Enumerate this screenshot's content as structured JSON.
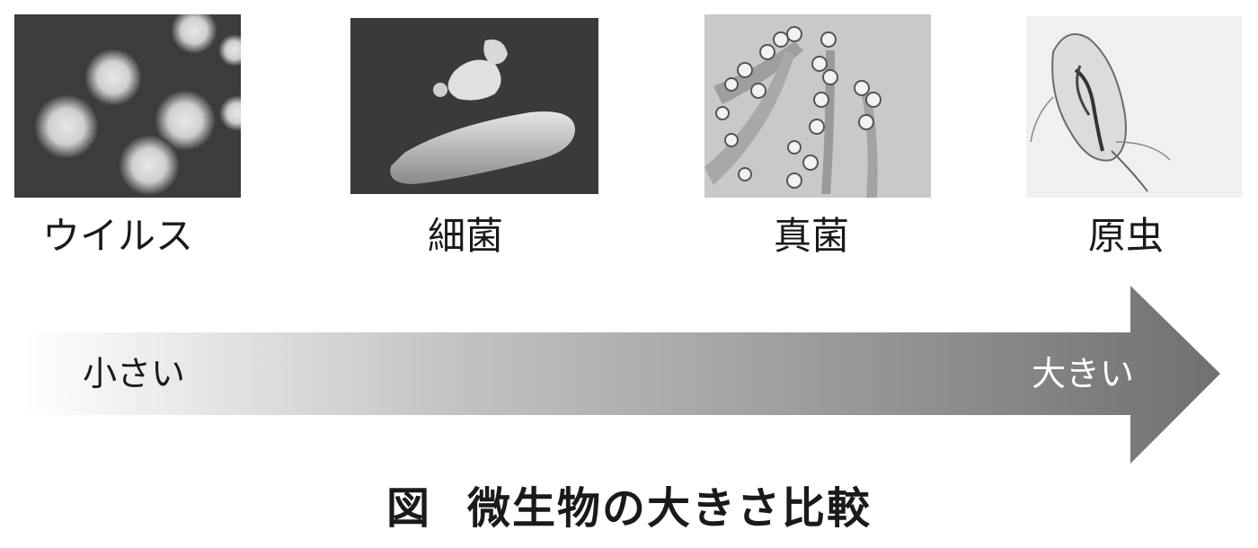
{
  "panels": [
    {
      "label": "ウイルス"
    },
    {
      "label": "細菌"
    },
    {
      "label": "真菌"
    },
    {
      "label": "原虫"
    }
  ],
  "arrow": {
    "small_label": "小さい",
    "large_label": "大きい"
  },
  "figure": {
    "prefix": "図",
    "title": "微生物の大きさ比較"
  }
}
